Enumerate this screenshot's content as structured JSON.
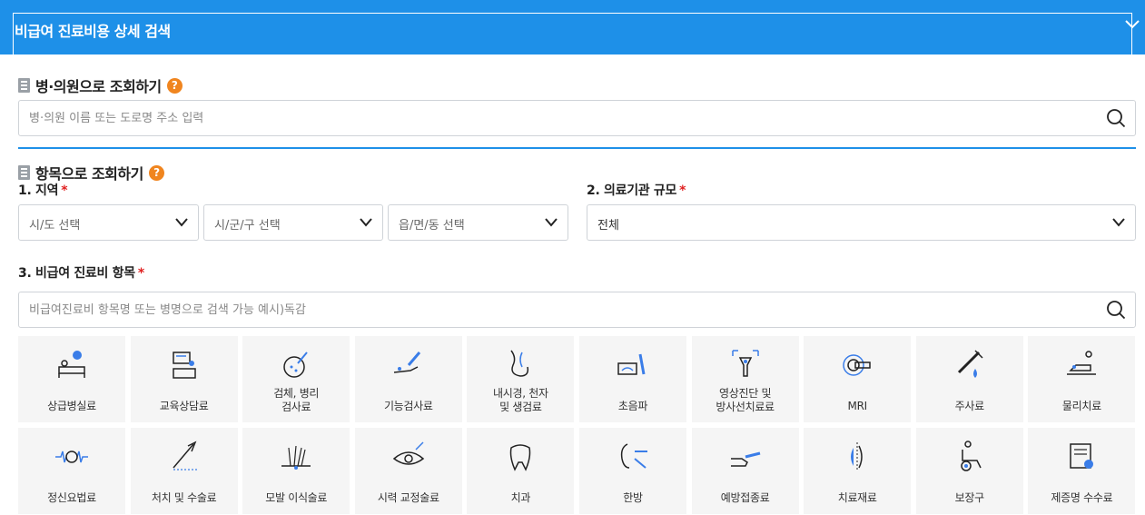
{
  "header": {
    "title": "비급여 진료비용 상세 검색"
  },
  "hospital_search": {
    "title": "병·의원으로 조회하기",
    "placeholder": "병·의원 이름 또는 도로명 주소 입력"
  },
  "item_search": {
    "title": "항목으로 조회하기",
    "region_label": "1. 지역",
    "region_selects": [
      "시/도 선택",
      "시/군/구 선택",
      "읍/면/동 선택"
    ],
    "scale_label": "2. 의료기관 규모",
    "scale_value": "전체",
    "item_label": "3. 비급여 진료비 항목",
    "item_placeholder": "비급여진료비 항목명 또는 병명으로 검색 가능 예시)독감",
    "required_mark": "*",
    "help_mark": "?"
  },
  "categories": [
    {
      "line1": "상급병실료",
      "line2": "",
      "icon": "bed-icon"
    },
    {
      "line1": "교육상담료",
      "line2": "",
      "icon": "consult-icon"
    },
    {
      "line1": "검체, 병리",
      "line2": "검사료",
      "icon": "petri-icon"
    },
    {
      "line1": "기능검사료",
      "line2": "",
      "icon": "arm-test-icon"
    },
    {
      "line1": "내시경, 천자",
      "line2": "및 생검료",
      "icon": "endoscope-icon"
    },
    {
      "line1": "초음파",
      "line2": "",
      "icon": "ultrasound-icon"
    },
    {
      "line1": "영상진단 및",
      "line2": "방사선치료료",
      "icon": "xray-icon"
    },
    {
      "line1": "MRI",
      "line2": "",
      "icon": "mri-icon"
    },
    {
      "line1": "주사료",
      "line2": "",
      "icon": "syringe-icon"
    },
    {
      "line1": "물리치료",
      "line2": "",
      "icon": "physio-icon"
    },
    {
      "line1": "정신요법료",
      "line2": "",
      "icon": "brain-wave-icon"
    },
    {
      "line1": "처치 및 수술료",
      "line2": "",
      "icon": "scalpel-icon"
    },
    {
      "line1": "모발 이식술료",
      "line2": "",
      "icon": "hair-icon"
    },
    {
      "line1": "시력 교정술료",
      "line2": "",
      "icon": "eye-icon"
    },
    {
      "line1": "치과",
      "line2": "",
      "icon": "tooth-icon"
    },
    {
      "line1": "한방",
      "line2": "",
      "icon": "acupuncture-icon"
    },
    {
      "line1": "예방접종료",
      "line2": "",
      "icon": "vaccine-icon"
    },
    {
      "line1": "치료재료",
      "line2": "",
      "icon": "material-icon"
    },
    {
      "line1": "보장구",
      "line2": "",
      "icon": "wheelchair-icon"
    },
    {
      "line1": "제증명 수수료",
      "line2": "",
      "icon": "certificate-icon"
    }
  ]
}
